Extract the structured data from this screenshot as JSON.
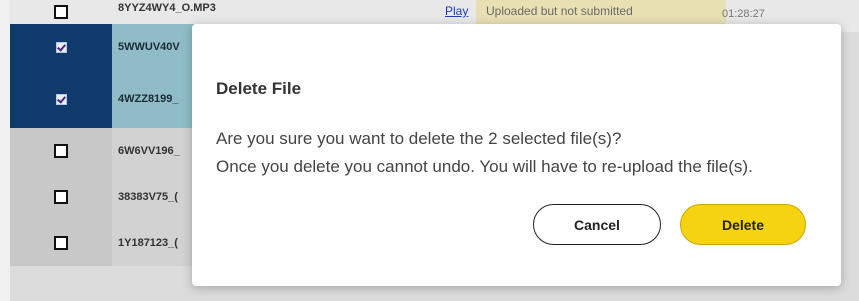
{
  "table": {
    "top_row": {
      "filename": "8YYZ4WY4_O.MP3",
      "play_label": "Play",
      "status": "Uploaded but not submitted",
      "time": "01:28:27"
    },
    "rows": [
      {
        "filename": "5WWUV40V",
        "checked": true
      },
      {
        "filename": "4WZZ8199_",
        "checked": true
      },
      {
        "filename": "6W6VV196_",
        "checked": false
      },
      {
        "filename": "38383V75_(",
        "checked": false
      },
      {
        "filename": "1Y187123_(",
        "checked": false
      }
    ]
  },
  "dialog": {
    "title": "Delete File",
    "message_line1": "Are you sure you want to delete the 2 selected file(s)?",
    "message_line2": "Once you delete you cannot undo. You will have to re-upload the file(s).",
    "cancel_label": "Cancel",
    "delete_label": "Delete"
  },
  "colors": {
    "accent_yellow": "#f5d310",
    "selected_row_dark": "#0f3a6b",
    "selected_row_light": "#8fbcc7"
  }
}
